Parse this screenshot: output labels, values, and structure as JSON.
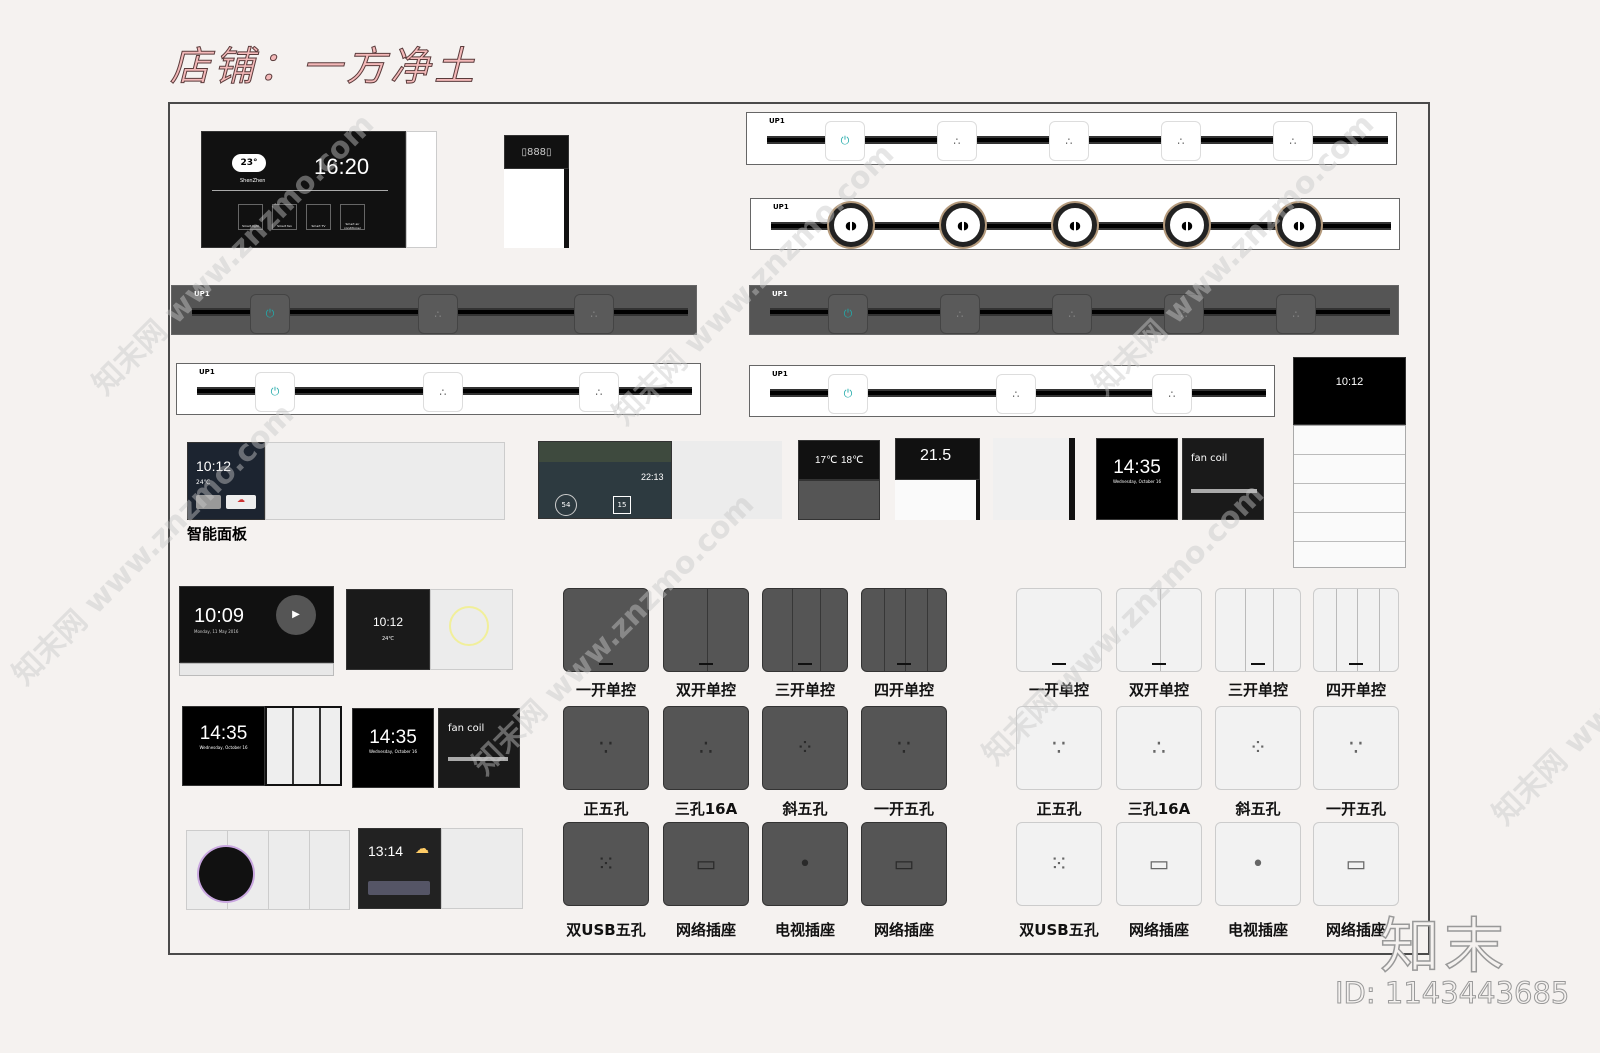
{
  "title": "店铺：一方净土",
  "section_label": "智能面板",
  "strip_label": "UP1",
  "watermark": "知末网 www.znzmo.com",
  "brand": "知末",
  "id_text": "ID: 1143443685",
  "screens": {
    "main": {
      "time": "16:20",
      "temp": "23°",
      "city": "ShenZhen",
      "buttons": [
        "Smart light",
        "Smart fan",
        "Smart TV",
        "Smart air conditioner"
      ]
    },
    "panel1": {
      "time": "10:12",
      "temp": "24℃"
    },
    "panel2": {
      "time": "22:13",
      "ring": "54",
      "temp": "15"
    },
    "thermo1": {
      "left": "17℃",
      "right": "18℃"
    },
    "thermo2": {
      "value": "21.5"
    },
    "clock": {
      "time": "14:35",
      "date": "Wednesday, October 16"
    },
    "fancoil": {
      "title": "fan coil"
    },
    "tall": {
      "time": "10:12"
    },
    "video": {
      "time": "10:09",
      "date": "Monday, 11 May 2016"
    },
    "square": {
      "time": "10:12",
      "temp": "24℃"
    },
    "clock2": {
      "time": "14:35",
      "date": "Wednesday, October 16"
    },
    "clock3": {
      "time": "14:35",
      "date": "Wednesday, October 16"
    },
    "fancoil2": {
      "title": "fan coil"
    },
    "weather": {
      "time": "13:14"
    }
  },
  "switch_rows": [
    {
      "labels": [
        "一开单控",
        "双开单控",
        "三开单控",
        "四开单控"
      ],
      "type": "gang"
    },
    {
      "labels": [
        "正五孔",
        "三孔16A",
        "斜五孔",
        "一开五孔"
      ],
      "type": "socket"
    },
    {
      "labels": [
        "双USB五孔",
        "网络插座",
        "电视插座",
        "网络插座"
      ],
      "type": "data"
    }
  ],
  "colors": {
    "background": "#f5f2f0",
    "dark_panel": "#555555",
    "light_panel": "#f2f2f2",
    "title": "#f4b9b9"
  }
}
